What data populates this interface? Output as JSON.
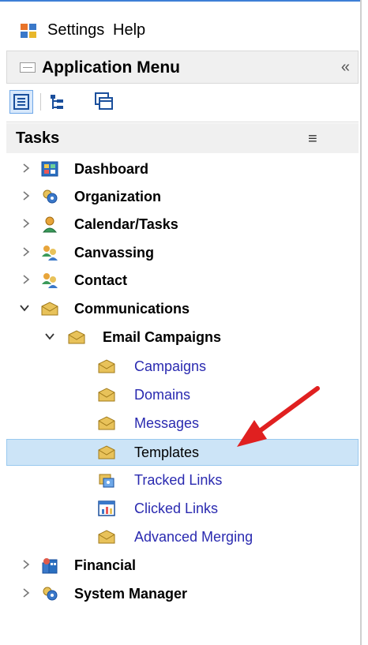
{
  "menubar": {
    "settings": "Settings",
    "help": "Help"
  },
  "app_menu": {
    "title": "Application Menu",
    "collapse": "«"
  },
  "tasks": {
    "title": "Tasks"
  },
  "tree": [
    {
      "label": "Dashboard"
    },
    {
      "label": "Organization"
    },
    {
      "label": "Calendar/Tasks"
    },
    {
      "label": "Canvassing"
    },
    {
      "label": "Contact"
    },
    {
      "label": "Communications"
    },
    {
      "label": "Email Campaigns"
    },
    {
      "label": "Campaigns"
    },
    {
      "label": "Domains"
    },
    {
      "label": "Messages"
    },
    {
      "label": "Templates",
      "selected": true
    },
    {
      "label": "Tracked Links"
    },
    {
      "label": "Clicked Links"
    },
    {
      "label": "Advanced Merging"
    },
    {
      "label": "Financial"
    },
    {
      "label": "System Manager"
    }
  ],
  "colors": {
    "link": "#2a2ab0",
    "selected_bg": "#cce4f7",
    "arrow": "#e02020"
  }
}
